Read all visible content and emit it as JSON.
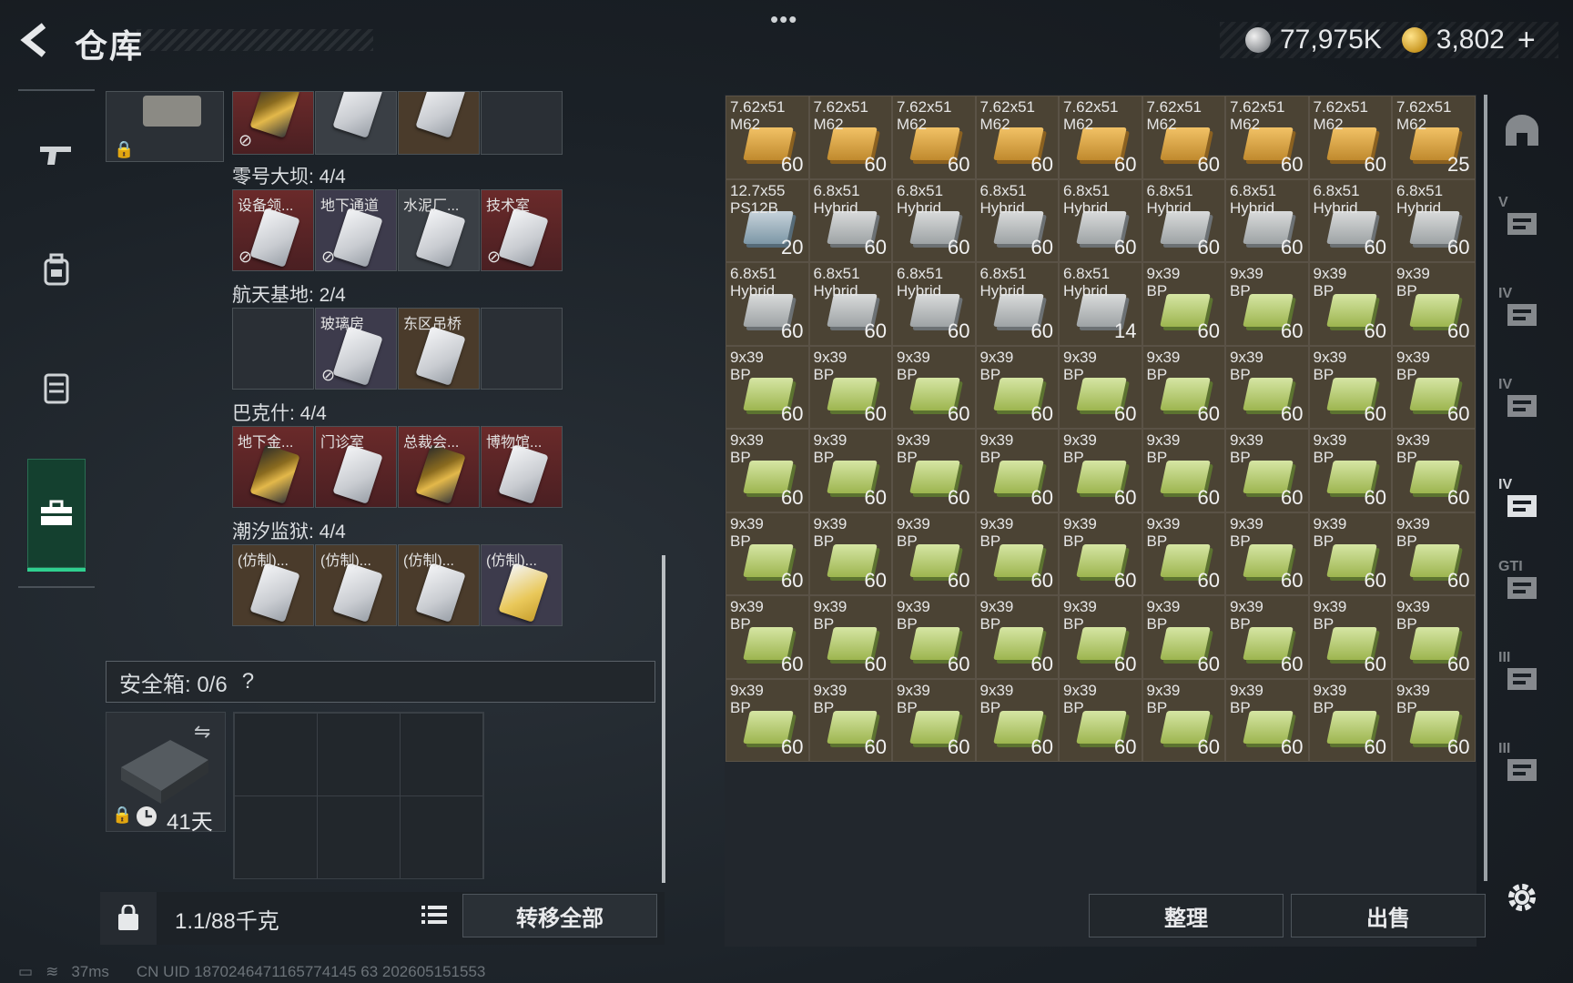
{
  "header": {
    "title": "仓库",
    "menu_dots": "•••"
  },
  "currency": {
    "silver": "77,975K",
    "gold": "3,802",
    "plus": "+"
  },
  "keys": {
    "groups": [
      {
        "title": "零号大坝: 4/4",
        "slots": [
          {
            "label": "设备领...",
            "color": "red",
            "card": "silver",
            "no_insure": true
          },
          {
            "label": "地下通道",
            "color": "purple",
            "card": "silver",
            "no_insure": true
          },
          {
            "label": "水泥厂...",
            "color": "gray",
            "card": "silver",
            "no_insure": false
          },
          {
            "label": "技术室",
            "color": "red",
            "card": "silver",
            "no_insure": true
          }
        ]
      },
      {
        "title": "航天基地: 2/4",
        "slots": [
          {
            "label": "",
            "color": "empty",
            "card": "",
            "no_insure": false
          },
          {
            "label": "玻璃房",
            "color": "purple",
            "card": "silver",
            "no_insure": true
          },
          {
            "label": "东区吊桥",
            "color": "brown",
            "card": "silver",
            "no_insure": false
          },
          {
            "label": "",
            "color": "empty",
            "card": "",
            "no_insure": false
          }
        ]
      },
      {
        "title": "巴克什: 4/4",
        "slots": [
          {
            "label": "地下金...",
            "color": "red",
            "card": "gold",
            "no_insure": false
          },
          {
            "label": "门诊室",
            "color": "red",
            "card": "silver",
            "no_insure": false
          },
          {
            "label": "总裁会...",
            "color": "red",
            "card": "gold",
            "no_insure": false
          },
          {
            "label": "博物馆...",
            "color": "red",
            "card": "silver",
            "no_insure": false
          }
        ]
      },
      {
        "title": "潮汐监狱: 4/4",
        "slots": [
          {
            "label": "(仿制)...",
            "color": "brown",
            "card": "silver",
            "no_insure": false
          },
          {
            "label": "(仿制)...",
            "color": "brown",
            "card": "silver",
            "no_insure": false
          },
          {
            "label": "(仿制)...",
            "color": "brown",
            "card": "silver",
            "no_insure": false
          },
          {
            "label": "(仿制)...",
            "color": "purple",
            "card": "yellow",
            "no_insure": false
          }
        ]
      }
    ]
  },
  "safe_box": {
    "label": "安全箱: 0/6",
    "help": "?",
    "days": "41天"
  },
  "footer_left": {
    "weight": "1.1/88千克",
    "transfer_all": "转移全部"
  },
  "stash": {
    "items": [
      {
        "name": "7.62x51\nM62",
        "qty": "60",
        "box": "orange"
      },
      {
        "name": "7.62x51\nM62",
        "qty": "60",
        "box": "orange"
      },
      {
        "name": "7.62x51\nM62",
        "qty": "60",
        "box": "orange"
      },
      {
        "name": "7.62x51\nM62",
        "qty": "60",
        "box": "orange"
      },
      {
        "name": "7.62x51\nM62",
        "qty": "60",
        "box": "orange"
      },
      {
        "name": "7.62x51\nM62",
        "qty": "60",
        "box": "orange"
      },
      {
        "name": "7.62x51\nM62",
        "qty": "60",
        "box": "orange"
      },
      {
        "name": "7.62x51\nM62",
        "qty": "60",
        "box": "orange"
      },
      {
        "name": "7.62x51\nM62",
        "qty": "25",
        "box": "orange"
      },
      {
        "name": "12.7x55\nPS12B",
        "qty": "20",
        "box": "steel"
      },
      {
        "name": "6.8x51\nHybrid",
        "qty": "60",
        "box": "gray"
      },
      {
        "name": "6.8x51\nHybrid",
        "qty": "60",
        "box": "gray"
      },
      {
        "name": "6.8x51\nHybrid",
        "qty": "60",
        "box": "gray"
      },
      {
        "name": "6.8x51\nHybrid",
        "qty": "60",
        "box": "gray"
      },
      {
        "name": "6.8x51\nHybrid",
        "qty": "60",
        "box": "gray"
      },
      {
        "name": "6.8x51\nHybrid",
        "qty": "60",
        "box": "gray"
      },
      {
        "name": "6.8x51\nHybrid",
        "qty": "60",
        "box": "gray"
      },
      {
        "name": "6.8x51\nHybrid",
        "qty": "60",
        "box": "gray"
      },
      {
        "name": "6.8x51\nHybrid",
        "qty": "60",
        "box": "gray"
      },
      {
        "name": "6.8x51\nHybrid",
        "qty": "60",
        "box": "gray"
      },
      {
        "name": "6.8x51\nHybrid",
        "qty": "60",
        "box": "gray"
      },
      {
        "name": "6.8x51\nHybrid",
        "qty": "60",
        "box": "gray"
      },
      {
        "name": "6.8x51\nHybrid",
        "qty": "14",
        "box": "gray"
      },
      {
        "name": "9x39\nBP",
        "qty": "60",
        "box": "green"
      },
      {
        "name": "9x39\nBP",
        "qty": "60",
        "box": "green"
      },
      {
        "name": "9x39\nBP",
        "qty": "60",
        "box": "green"
      },
      {
        "name": "9x39\nBP",
        "qty": "60",
        "box": "green"
      },
      {
        "name": "9x39\nBP",
        "qty": "60",
        "box": "green"
      },
      {
        "name": "9x39\nBP",
        "qty": "60",
        "box": "green"
      },
      {
        "name": "9x39\nBP",
        "qty": "60",
        "box": "green"
      },
      {
        "name": "9x39\nBP",
        "qty": "60",
        "box": "green"
      },
      {
        "name": "9x39\nBP",
        "qty": "60",
        "box": "green"
      },
      {
        "name": "9x39\nBP",
        "qty": "60",
        "box": "green"
      },
      {
        "name": "9x39\nBP",
        "qty": "60",
        "box": "green"
      },
      {
        "name": "9x39\nBP",
        "qty": "60",
        "box": "green"
      },
      {
        "name": "9x39\nBP",
        "qty": "60",
        "box": "green"
      },
      {
        "name": "9x39\nBP",
        "qty": "60",
        "box": "green"
      },
      {
        "name": "9x39\nBP",
        "qty": "60",
        "box": "green"
      },
      {
        "name": "9x39\nBP",
        "qty": "60",
        "box": "green"
      },
      {
        "name": "9x39\nBP",
        "qty": "60",
        "box": "green"
      },
      {
        "name": "9x39\nBP",
        "qty": "60",
        "box": "green"
      },
      {
        "name": "9x39\nBP",
        "qty": "60",
        "box": "green"
      },
      {
        "name": "9x39\nBP",
        "qty": "60",
        "box": "green"
      },
      {
        "name": "9x39\nBP",
        "qty": "60",
        "box": "green"
      },
      {
        "name": "9x39\nBP",
        "qty": "60",
        "box": "green"
      },
      {
        "name": "9x39\nBP",
        "qty": "60",
        "box": "green"
      },
      {
        "name": "9x39\nBP",
        "qty": "60",
        "box": "green"
      },
      {
        "name": "9x39\nBP",
        "qty": "60",
        "box": "green"
      },
      {
        "name": "9x39\nBP",
        "qty": "60",
        "box": "green"
      },
      {
        "name": "9x39\nBP",
        "qty": "60",
        "box": "green"
      },
      {
        "name": "9x39\nBP",
        "qty": "60",
        "box": "green"
      },
      {
        "name": "9x39\nBP",
        "qty": "60",
        "box": "green"
      },
      {
        "name": "9x39\nBP",
        "qty": "60",
        "box": "green"
      },
      {
        "name": "9x39\nBP",
        "qty": "60",
        "box": "green"
      },
      {
        "name": "9x39\nBP",
        "qty": "60",
        "box": "green"
      },
      {
        "name": "9x39\nBP",
        "qty": "60",
        "box": "green"
      },
      {
        "name": "9x39\nBP",
        "qty": "60",
        "box": "green"
      },
      {
        "name": "9x39\nBP",
        "qty": "60",
        "box": "green"
      },
      {
        "name": "9x39\nBP",
        "qty": "60",
        "box": "green"
      },
      {
        "name": "9x39\nBP",
        "qty": "60",
        "box": "green"
      },
      {
        "name": "9x39\nBP",
        "qty": "60",
        "box": "green"
      },
      {
        "name": "9x39\nBP",
        "qty": "60",
        "box": "green"
      },
      {
        "name": "9x39\nBP",
        "qty": "60",
        "box": "green"
      },
      {
        "name": "9x39\nBP",
        "qty": "60",
        "box": "green"
      },
      {
        "name": "9x39\nBP",
        "qty": "60",
        "box": "green"
      },
      {
        "name": "9x39\nBP",
        "qty": "60",
        "box": "green"
      },
      {
        "name": "9x39\nBP",
        "qty": "60",
        "box": "green"
      },
      {
        "name": "9x39\nBP",
        "qty": "60",
        "box": "green"
      },
      {
        "name": "9x39\nBP",
        "qty": "60",
        "box": "green"
      },
      {
        "name": "9x39\nBP",
        "qty": "60",
        "box": "green"
      },
      {
        "name": "9x39\nBP",
        "qty": "60",
        "box": "green"
      },
      {
        "name": "9x39\nBP",
        "qty": "60",
        "box": "green"
      }
    ]
  },
  "right_nav": {
    "tiers": [
      "",
      "V",
      "IV",
      "IV",
      "IV",
      "GTI",
      "III",
      "III"
    ]
  },
  "actions": {
    "sort": "整理",
    "sell": "出售"
  },
  "status_bar": {
    "ping": "37ms",
    "uid": "CN UID 1870246471165774145 63 202605151553"
  }
}
